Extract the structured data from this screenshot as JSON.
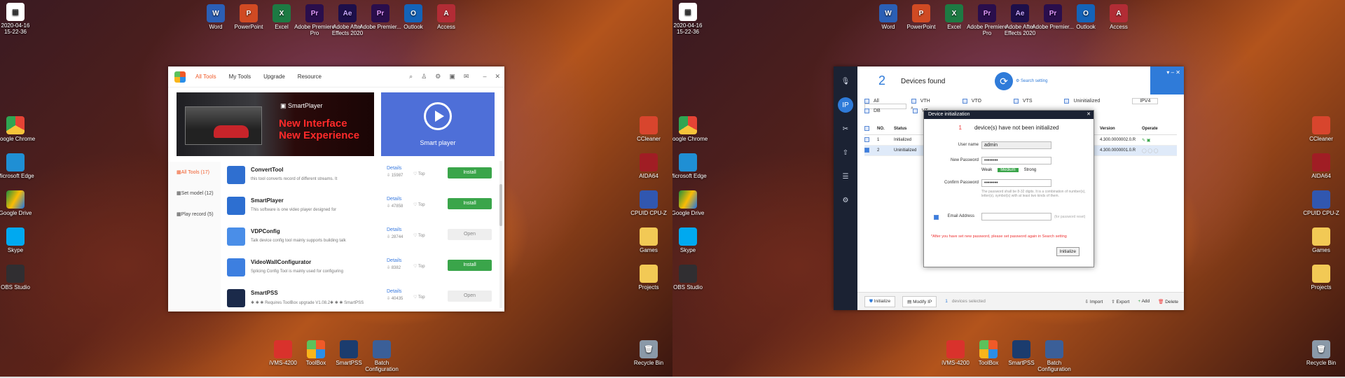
{
  "desktop": {
    "clock_date": "2020-04-16",
    "clock_time": "15-22-36",
    "top_icons": [
      {
        "label": "Word",
        "glyph": "W",
        "cls": "g-word"
      },
      {
        "label": "PowerPoint",
        "glyph": "P",
        "cls": "g-pp"
      },
      {
        "label": "Excel",
        "glyph": "X",
        "cls": "g-xl"
      },
      {
        "label": "Adobe Premiere Pro",
        "glyph": "Pr",
        "cls": "g-pr"
      },
      {
        "label": "Adobe After Effects 2020",
        "glyph": "Ae",
        "cls": "g-ae"
      },
      {
        "label": "Adobe Premier...",
        "glyph": "Pr",
        "cls": "g-pr"
      },
      {
        "label": "Outlook",
        "glyph": "O",
        "cls": "g-ol"
      },
      {
        "label": "Access",
        "glyph": "A",
        "cls": "g-ac"
      }
    ],
    "left_icons": [
      {
        "label": "Google Chrome",
        "cls": "g-chrome"
      },
      {
        "label": "Microsoft Edge",
        "cls": "g-edge"
      },
      {
        "label": "Google Drive",
        "cls": "g-gd"
      },
      {
        "label": "Skype",
        "cls": "g-skype"
      },
      {
        "label": "OBS Studio",
        "cls": "g-obs"
      }
    ],
    "right_icons": [
      {
        "label": "CCleaner",
        "cls": "g-cc"
      },
      {
        "label": "AIDA64",
        "cls": "g-aida"
      },
      {
        "label": "CPUID CPU-Z",
        "cls": "g-cpu"
      },
      {
        "label": "Games",
        "cls": "g-folder"
      },
      {
        "label": "Projects",
        "cls": "g-folder"
      }
    ],
    "bottom_icons": [
      {
        "label": "iVMS-4200",
        "cls": "g-ivms"
      },
      {
        "label": "ToolBox",
        "cls": "g-tb"
      },
      {
        "label": "SmartPSS",
        "cls": "g-spss"
      },
      {
        "label": "Batch Configuration",
        "cls": "g-batch"
      }
    ],
    "recycle": "Recycle Bin"
  },
  "toolbox": {
    "tabs": [
      "All Tools",
      "My Tools",
      "Upgrade",
      "Resource"
    ],
    "banner_product": "SmartPlayer",
    "banner_line1": "New Interface",
    "banner_line2": "New Experience",
    "card_label": "Smart player",
    "sidebar": [
      "All Tools (17)",
      "Set model (12)",
      "Play record (5)"
    ],
    "rows": [
      {
        "name": "ConvertTool",
        "desc": "this tool converts record of different streams. It",
        "count": "15987",
        "btn": "Install",
        "color": "#2f6fd0"
      },
      {
        "name": "SmartPlayer",
        "desc": "This software is one video player designed for",
        "count": "47858",
        "btn": "Install",
        "color": "#2d6fd1"
      },
      {
        "name": "VDPConfig",
        "desc": "Talk device config tool mainly supports building talk",
        "count": "28744",
        "btn": "Open",
        "color": "#4a8ee8"
      },
      {
        "name": "VideoWallConfigurator",
        "desc": "Splicing Config Tool is mainly used for configuring",
        "count": "8382",
        "btn": "Install",
        "color": "#3d7fe0"
      },
      {
        "name": "SmartPSS",
        "desc": "✱ ✱ ✱ Requires ToolBox upgrade V1.08.2✱ ✱ ✱ SmartPSS",
        "count": "40435",
        "btn": "Open",
        "color": "#1b2a4a"
      }
    ],
    "details": "Details",
    "top": "Top"
  },
  "config": {
    "count": "2",
    "found": "Devices found",
    "search_setting": "Search setting",
    "filters_row1": [
      "All",
      "VTH",
      "VTO",
      "VTS",
      "Uninitialized"
    ],
    "filters_row2": [
      "DB",
      "VT"
    ],
    "ip_select": "IPV4",
    "table_head": [
      "NO.",
      "Status",
      "Version",
      "Operate"
    ],
    "rows": [
      {
        "no": "1",
        "status": "Initialized",
        "version": "4.300.0000002.0.R"
      },
      {
        "no": "2",
        "status": "Uninitialized",
        "version": "4.300.0000001.0.R"
      }
    ],
    "bottom": [
      "Initialize",
      "Modify IP",
      "1",
      "devices selected",
      "Import",
      "Export",
      "Add",
      "Delete"
    ],
    "dialog": {
      "title": "Device initialization",
      "num": "1",
      "msg": "device(s) have not been initialized",
      "user_label": "User name",
      "user_value": "admin",
      "newpw_label": "New Password",
      "newpw_value": "••••••••",
      "weak": "Weak",
      "medium": "Medium",
      "strong": "Strong",
      "confirm_label": "Confirm Password",
      "confirm_value": "••••••••",
      "hint": "The password shall be 8-32 digits. It is a combination of number(s), letter(s), symbol(s) with at least two kinds of them.",
      "email_label": "Email Address",
      "email_placeholder": "(for password reset)",
      "warn": "*After you have set new password, please set password again in Search setting",
      "init_btn": "Initialize"
    }
  }
}
